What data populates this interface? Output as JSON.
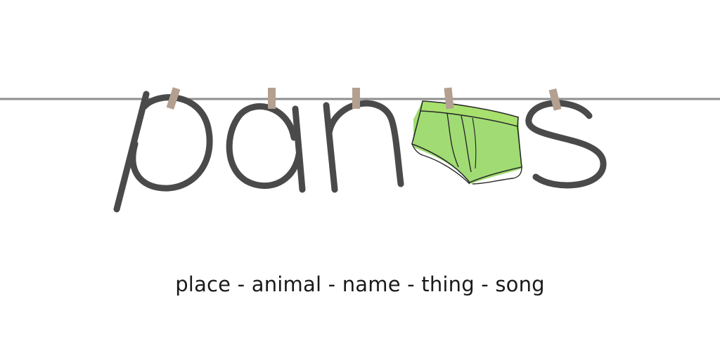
{
  "brand": {
    "logo_text": "panos",
    "logo_glyph_icon": "briefs-icon"
  },
  "tagline": "place - animal - name - thing - song",
  "colors": {
    "background": "#ffffff",
    "letters": "#4a4a4a",
    "line": "#8e8e8e",
    "clothespin": "#b4a090",
    "briefs_fill": "#8fd65a",
    "tagline_text": "#1a1a1a"
  }
}
